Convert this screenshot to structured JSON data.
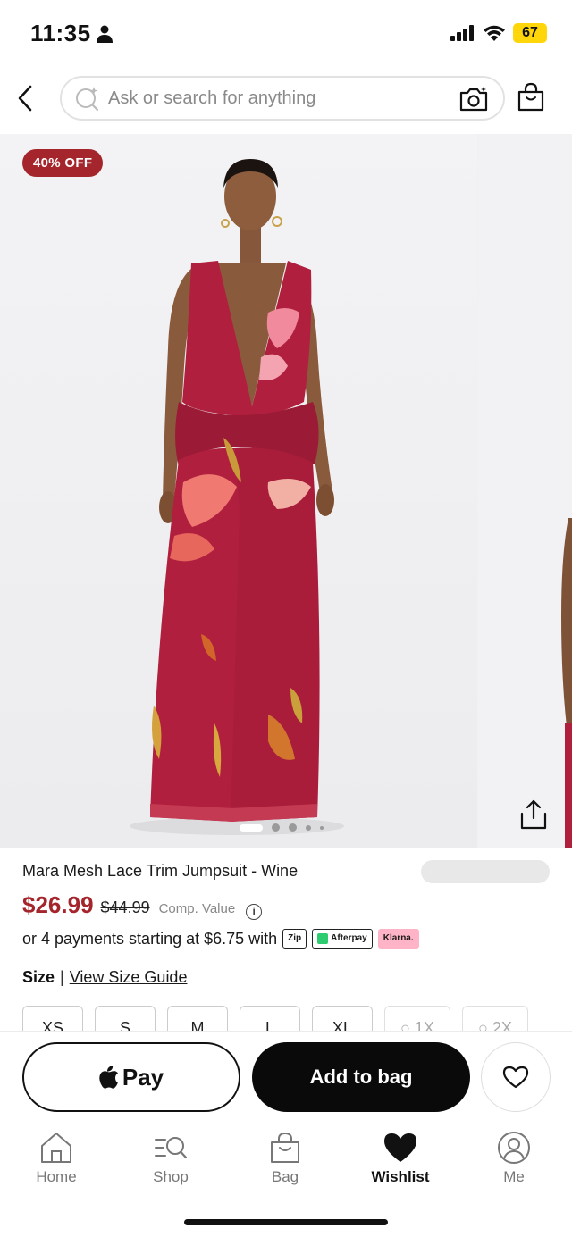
{
  "status_bar": {
    "time": "11:35",
    "battery": "67"
  },
  "search": {
    "placeholder": "Ask or search for anything"
  },
  "hero": {
    "discount_badge": "40% OFF",
    "image_count": 5,
    "active_image_index": 0
  },
  "product": {
    "name": "Mara Mesh Lace Trim Jumpsuit - Wine",
    "sale_price": "$26.99",
    "original_price": "$44.99",
    "comp_value_label": "Comp. Value",
    "installments_text": "or 4 payments starting at $6.75 with",
    "payment_providers": [
      "Zip",
      "Afterpay",
      "Klarna."
    ]
  },
  "size": {
    "label": "Size",
    "guide_link": "View Size Guide",
    "options": [
      {
        "label": "XS",
        "available": true
      },
      {
        "label": "S",
        "available": true
      },
      {
        "label": "M",
        "available": true
      },
      {
        "label": "L",
        "available": true
      },
      {
        "label": "XL",
        "available": true
      },
      {
        "label": "1X",
        "available": false
      },
      {
        "label": "2X",
        "available": false
      }
    ]
  },
  "actions": {
    "apple_pay_label": "Pay",
    "add_to_bag_label": "Add to bag"
  },
  "tabs": [
    {
      "label": "Home",
      "icon": "home-icon",
      "active": false
    },
    {
      "label": "Shop",
      "icon": "shop-search-icon",
      "active": false
    },
    {
      "label": "Bag",
      "icon": "bag-icon",
      "active": false
    },
    {
      "label": "Wishlist",
      "icon": "heart-icon",
      "active": true
    },
    {
      "label": "Me",
      "icon": "profile-icon",
      "active": false
    }
  ],
  "colors": {
    "sale_red": "#a4262c",
    "battery_yellow": "#ffd60a",
    "garment_wine": "#b01f3e"
  }
}
